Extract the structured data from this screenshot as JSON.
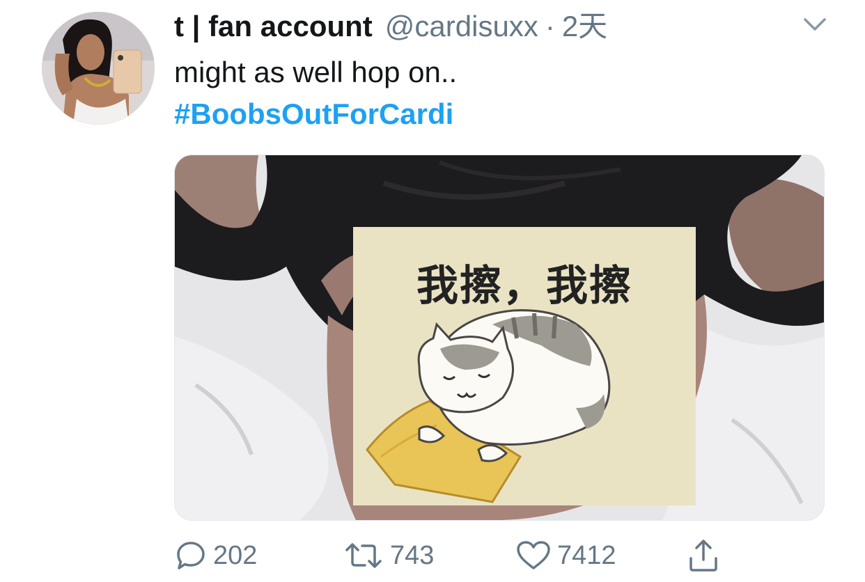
{
  "tweet": {
    "display_name": "t | fan account",
    "handle": "@cardisuxx",
    "separator": "·",
    "time": "2天",
    "text": "might as well hop on..",
    "hashtag": "#BoobsOutForCardi",
    "media": {
      "sticker_text": "我擦，我擦"
    },
    "actions": {
      "reply_count": "202",
      "retweet_count": "743",
      "like_count": "7412"
    }
  },
  "colors": {
    "link": "#1da1f2",
    "secondary_text": "#657786",
    "primary_text": "#14171a"
  },
  "icons": [
    "chevron-down-icon",
    "reply-icon",
    "retweet-icon",
    "like-icon",
    "share-icon"
  ]
}
